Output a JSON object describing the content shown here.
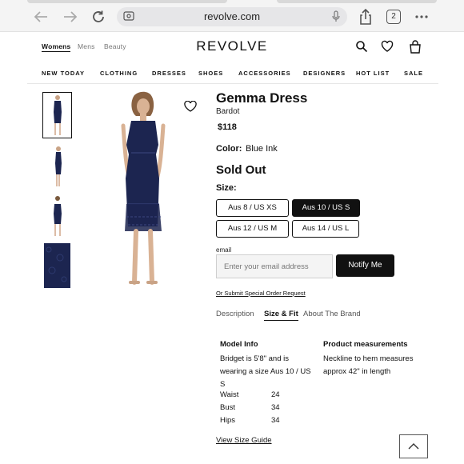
{
  "browser": {
    "url": "revolve.com",
    "tab_count": "2"
  },
  "site": {
    "logo": "REVOLVE",
    "gender_tabs": [
      "Womens",
      "Mens",
      "Beauty"
    ],
    "categories": [
      "NEW TODAY",
      "CLOTHING",
      "DRESSES",
      "SHOES",
      "ACCESSORIES",
      "DESIGNERS",
      "HOT LIST",
      "SALE"
    ]
  },
  "product": {
    "title": "Gemma Dress",
    "brand": "Bardot",
    "price": "$118",
    "color_label": "Color:",
    "color_value": "Blue Ink",
    "availability": "Sold Out",
    "size_label": "Size:",
    "sizes": [
      "Aus 8 / US XS",
      "Aus 10 / US S",
      "Aus 12 / US M",
      "Aus 14 / US L"
    ],
    "selected_size": "Aus 10 / US S",
    "dress_color": "#1c2550"
  },
  "notify": {
    "email_label": "email",
    "email_placeholder": "Enter your email address",
    "button_label": "Notify Me",
    "special_order_link": "Or Submit Special Order Request"
  },
  "tabs": {
    "items": [
      "Description",
      "Size & Fit",
      "About The Brand"
    ],
    "active": "Size & Fit"
  },
  "size_fit": {
    "model_info_title": "Model Info",
    "model_info_text": "Bridget is 5'8\" and is wearing a size Aus 10 / US S",
    "measurements": [
      {
        "label": "Waist",
        "value": "24"
      },
      {
        "label": "Bust",
        "value": "34"
      },
      {
        "label": "Hips",
        "value": "34"
      }
    ],
    "product_measurements_title": "Product measurements",
    "product_measurements_text": "Neckline to hem measures approx 42\" in length",
    "size_guide_link": "View Size Guide"
  }
}
